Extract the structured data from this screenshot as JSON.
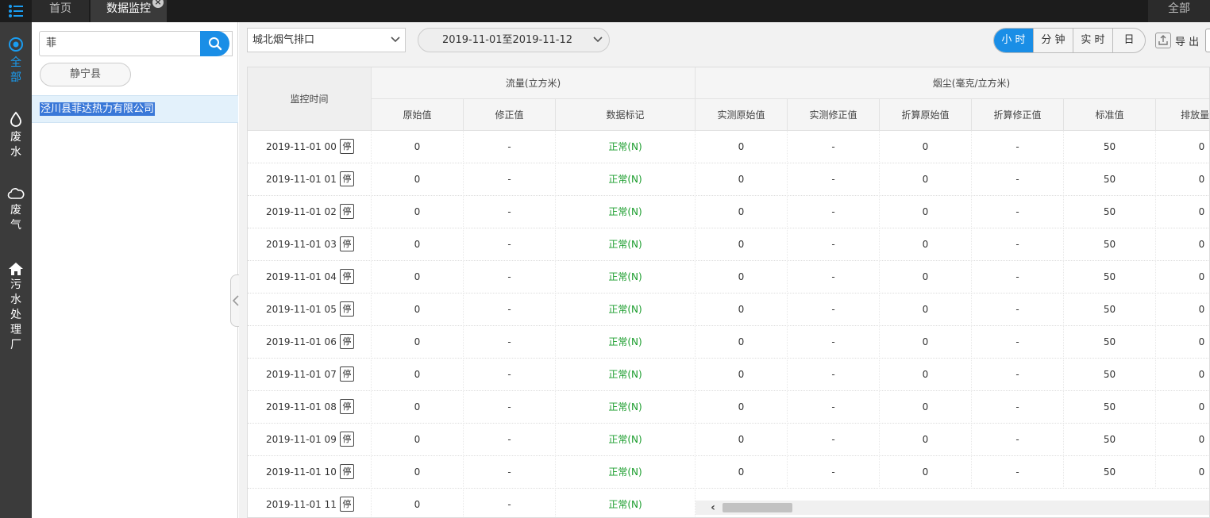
{
  "topbar": {
    "menu_icon": "menu-list-icon",
    "tabs": [
      {
        "label": "首页"
      },
      {
        "label": "数据监控",
        "close": "×"
      }
    ],
    "right_label": "全部"
  },
  "rail": {
    "items": [
      {
        "icon": "target-icon",
        "label": [
          "全",
          "部"
        ],
        "active": true
      },
      {
        "icon": "water-drop-icon",
        "label": [
          "废",
          "水"
        ]
      },
      {
        "icon": "cloud-icon",
        "label": [
          "废",
          "气"
        ]
      },
      {
        "icon": "house-icon",
        "label": [
          "污",
          "水",
          "处",
          "理",
          "厂"
        ]
      }
    ]
  },
  "side": {
    "search_value": "菲",
    "search_icon": "search-icon",
    "region": "静宁县",
    "company": "泾川县菲达热力有限公司"
  },
  "toolbar": {
    "outlet": "城北烟气排口",
    "date_range": "2019-11-01至2019-11-12",
    "granularity": [
      "小 时",
      "分 钟",
      "实 时",
      "日"
    ],
    "active_granularity": 0,
    "export_label": "导 出",
    "export_icon": "export-icon"
  },
  "table": {
    "time_header": "监控时间",
    "groups": [
      "流量(立方米)",
      "烟尘(毫克/立方米)"
    ],
    "columns": [
      "原始值",
      "修正值",
      "数据标记",
      "实测原始值",
      "实测修正值",
      "折算原始值",
      "折算修正值",
      "标准值",
      "排放量(千"
    ],
    "stop_label": "停",
    "rows": [
      {
        "time": "2019-11-01 00",
        "cells": [
          "0",
          "-",
          "正常(N)",
          "0",
          "-",
          "0",
          "-",
          "50",
          "0"
        ]
      },
      {
        "time": "2019-11-01 01",
        "cells": [
          "0",
          "-",
          "正常(N)",
          "0",
          "-",
          "0",
          "-",
          "50",
          "0"
        ]
      },
      {
        "time": "2019-11-01 02",
        "cells": [
          "0",
          "-",
          "正常(N)",
          "0",
          "-",
          "0",
          "-",
          "50",
          "0"
        ]
      },
      {
        "time": "2019-11-01 03",
        "cells": [
          "0",
          "-",
          "正常(N)",
          "0",
          "-",
          "0",
          "-",
          "50",
          "0"
        ]
      },
      {
        "time": "2019-11-01 04",
        "cells": [
          "0",
          "-",
          "正常(N)",
          "0",
          "-",
          "0",
          "-",
          "50",
          "0"
        ]
      },
      {
        "time": "2019-11-01 05",
        "cells": [
          "0",
          "-",
          "正常(N)",
          "0",
          "-",
          "0",
          "-",
          "50",
          "0"
        ]
      },
      {
        "time": "2019-11-01 06",
        "cells": [
          "0",
          "-",
          "正常(N)",
          "0",
          "-",
          "0",
          "-",
          "50",
          "0"
        ]
      },
      {
        "time": "2019-11-01 07",
        "cells": [
          "0",
          "-",
          "正常(N)",
          "0",
          "-",
          "0",
          "-",
          "50",
          "0"
        ]
      },
      {
        "time": "2019-11-01 08",
        "cells": [
          "0",
          "-",
          "正常(N)",
          "0",
          "-",
          "0",
          "-",
          "50",
          "0"
        ]
      },
      {
        "time": "2019-11-01 09",
        "cells": [
          "0",
          "-",
          "正常(N)",
          "0",
          "-",
          "0",
          "-",
          "50",
          "0"
        ]
      },
      {
        "time": "2019-11-01 10",
        "cells": [
          "0",
          "-",
          "正常(N)",
          "0",
          "-",
          "0",
          "-",
          "50",
          "0"
        ]
      },
      {
        "time": "2019-11-01 11",
        "cells": [
          "0",
          "-",
          "正常(N)"
        ]
      }
    ]
  },
  "colors": {
    "accent": "#1a8ee6",
    "ok": "#199c2b",
    "selection": "#3a78d8"
  }
}
